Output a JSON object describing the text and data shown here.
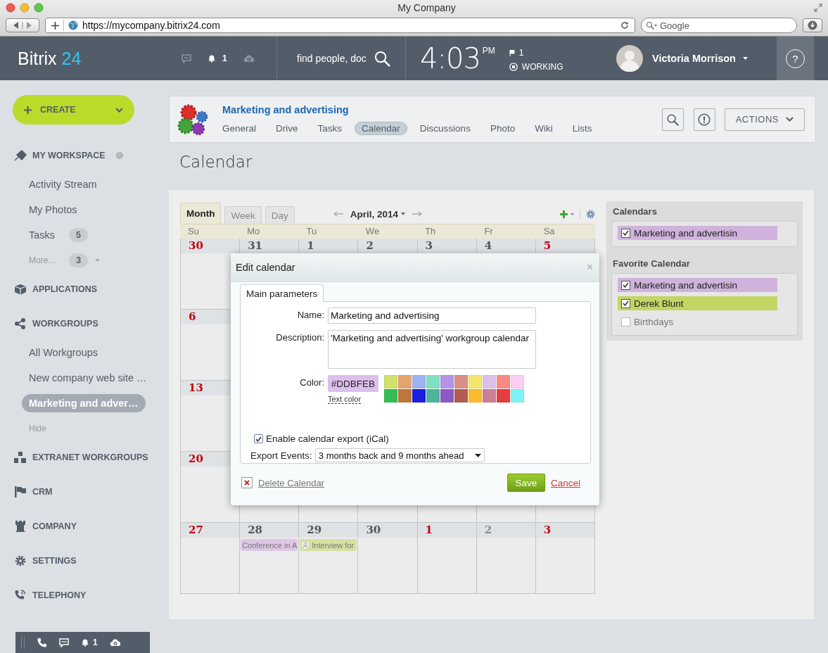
{
  "window": {
    "title": "My Company"
  },
  "browser": {
    "url": "https://mycompany.bitrix24.com",
    "search_placeholder": "Google"
  },
  "topbar": {
    "logo": "Bitrix",
    "logo_number": "24",
    "notifications": "1",
    "search_placeholder": "find people, doc",
    "time": "4:03",
    "meridiem": "PM",
    "flags": "1",
    "status": "WORKING",
    "user": "Victoria Morrison",
    "help": "?"
  },
  "sidebar": {
    "create": "CREATE",
    "items": [
      {
        "kind": "section",
        "label": "MY WORKSPACE"
      },
      {
        "kind": "link",
        "label": "Activity Stream",
        "selected": false
      },
      {
        "kind": "link",
        "label": "My Photos",
        "selected": false
      },
      {
        "kind": "link",
        "label": "Tasks",
        "count": "5",
        "selected": false
      },
      {
        "kind": "more",
        "label": "More...",
        "count": "3"
      },
      {
        "kind": "section",
        "label": "APPLICATIONS"
      },
      {
        "kind": "section",
        "label": "WORKGROUPS"
      },
      {
        "kind": "link",
        "label": "All Workgroups",
        "selected": false
      },
      {
        "kind": "link",
        "label": "New company web site …",
        "selected": false
      },
      {
        "kind": "link",
        "label": "Marketing and adver…",
        "selected": true
      },
      {
        "kind": "hint",
        "label": "Hide"
      },
      {
        "kind": "section",
        "label": "EXTRANET WORKGROUPS"
      },
      {
        "kind": "section",
        "label": "CRM"
      },
      {
        "kind": "section",
        "label": "COMPANY"
      },
      {
        "kind": "section",
        "label": "SETTINGS"
      },
      {
        "kind": "section",
        "label": "TELEPHONY"
      }
    ],
    "footer_notifications": "1"
  },
  "group": {
    "title": "Marketing and advertising",
    "tabs": [
      {
        "label": "General",
        "selected": false
      },
      {
        "label": "Drive",
        "selected": false
      },
      {
        "label": "Tasks",
        "selected": false
      },
      {
        "label": "Calendar",
        "selected": true
      },
      {
        "label": "Discussions",
        "selected": false
      },
      {
        "label": "Photo",
        "selected": false
      },
      {
        "label": "Wiki",
        "selected": false
      },
      {
        "label": "Lists",
        "selected": false
      }
    ],
    "actions": "ACTIONS"
  },
  "page_title": "Calendar",
  "calendar": {
    "views": [
      {
        "label": "Month",
        "selected": true
      },
      {
        "label": "Week",
        "selected": false
      },
      {
        "label": "Day",
        "selected": false
      }
    ],
    "period": "April, 2014",
    "weekdays": [
      "Su",
      "Mo",
      "Tu",
      "We",
      "Th",
      "Fr",
      "Sa"
    ],
    "weeks": [
      {
        "days": [
          {
            "day": "30",
            "kind": "holiday"
          },
          {
            "day": "31",
            "kind": "normal"
          },
          {
            "day": "1",
            "kind": "normal"
          },
          {
            "day": "2",
            "kind": "normal"
          },
          {
            "day": "3",
            "kind": "normal"
          },
          {
            "day": "4",
            "kind": "normal"
          },
          {
            "day": "5",
            "kind": "holiday"
          }
        ]
      },
      {
        "days": [
          {
            "day": "6",
            "kind": "holiday"
          }
        ]
      },
      {
        "days": [
          {
            "day": "13",
            "kind": "holiday"
          }
        ]
      },
      {
        "days": [
          {
            "day": "20",
            "kind": "holiday"
          }
        ]
      },
      {
        "days": [
          {
            "day": "27",
            "kind": "holiday"
          },
          {
            "day": "28",
            "kind": "normal",
            "events": [
              {
                "title": "Conference in A",
                "kind": "plain",
                "color": "#dfc6e6"
              }
            ]
          },
          {
            "day": "29",
            "kind": "normal",
            "events": [
              {
                "title": "Interview for",
                "kind": "person",
                "color": "#d6e0a0"
              }
            ]
          },
          {
            "day": "30",
            "kind": "normal"
          },
          {
            "day": "1",
            "kind": "holiday"
          },
          {
            "day": "2",
            "kind": "other"
          },
          {
            "day": "3",
            "kind": "holiday"
          }
        ]
      }
    ]
  },
  "calendars_panel": {
    "sections": [
      {
        "title": "Calendars",
        "items": [
          {
            "label": "Marketing and advertisin",
            "checked": true,
            "color": "#cfb3dc"
          }
        ]
      },
      {
        "title": "Favorite Calendar",
        "items": [
          {
            "label": "Marketing and advertisin",
            "checked": true,
            "color": "#cfb3dc"
          },
          {
            "label": "Derek Blunt",
            "checked": true,
            "color": "#c3d563"
          },
          {
            "label": "Birthdays",
            "checked": false
          }
        ]
      }
    ]
  },
  "dialog": {
    "title": "Edit calendar",
    "close": "×",
    "tab": "Main parameters",
    "name_label": "Name:",
    "name": "Marketing and advertising",
    "description_label": "Description:",
    "description": "'Marketing and advertising' workgroup calendar",
    "color_label": "Color:",
    "color": "#DDBFEB",
    "text_color": "Text color",
    "palette": [
      {
        "color": "#d0e26a"
      },
      {
        "color": "#e5a46c"
      },
      {
        "color": "#9eb1f2"
      },
      {
        "color": "#80dfc3"
      },
      {
        "color": "#b394e8"
      },
      {
        "color": "#d98f86"
      },
      {
        "color": "#f4e76a"
      },
      {
        "color": "#dcc0ea"
      },
      {
        "color": "#fa8a84"
      },
      {
        "color": "#fecdf5"
      },
      {
        "color": "#36bc55"
      },
      {
        "color": "#bd7839"
      },
      {
        "color": "#1c1ee0"
      },
      {
        "color": "#4cb59a"
      },
      {
        "color": "#8b5bc4"
      },
      {
        "color": "#b05e54"
      },
      {
        "color": "#fbbb2b"
      },
      {
        "color": "#c98095"
      },
      {
        "color": "#e33d3c"
      },
      {
        "color": "#7cf4f7"
      }
    ],
    "export": {
      "label": "Enable calendar export (iCal)",
      "checked": true
    },
    "export_events_label": "Export Events:",
    "export_events": "3 months back and 9 months ahead",
    "delete": "Delete Calendar",
    "save": "Save",
    "cancel": "Cancel"
  }
}
